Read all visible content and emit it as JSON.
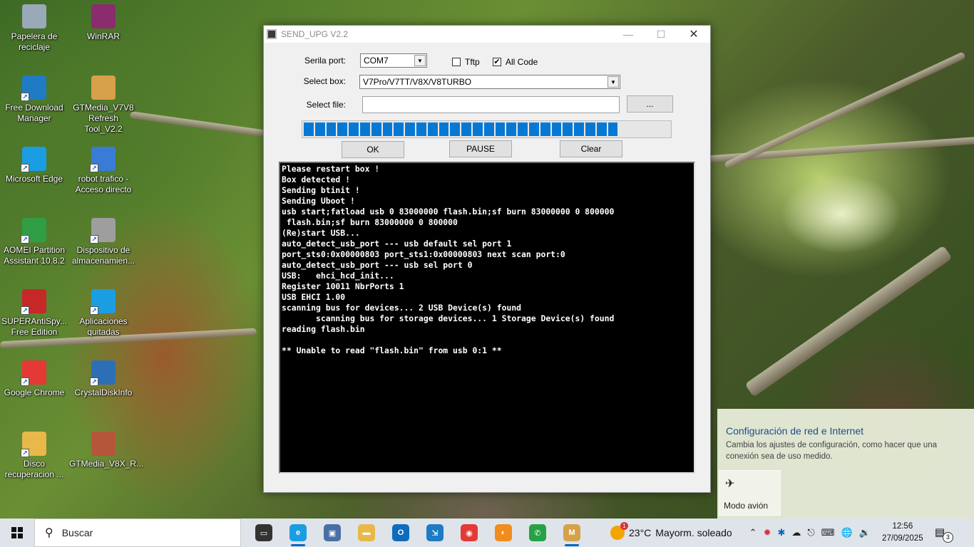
{
  "desktop": {
    "icons": [
      {
        "label": "Papelera de reciclaje",
        "icon": "recycle-bin-icon",
        "color": "#9aa9b8"
      },
      {
        "label": "WinRAR",
        "icon": "winrar-icon",
        "color": "#8b2c6e"
      },
      {
        "label": "Free Download Manager",
        "icon": "fdm-icon",
        "color": "#1f7bc4"
      },
      {
        "label": "GTMedia_V7V8 Refresh Tool_V2.2",
        "icon": "mfc-icon",
        "color": "#d6a14a"
      },
      {
        "label": "Microsoft Edge",
        "icon": "edge-icon",
        "color": "#1b9de2"
      },
      {
        "label": "robot trafico - Acceso directo",
        "icon": "shortcut-icon",
        "color": "#3a7bd5"
      },
      {
        "label": "AOMEI Partition Assistant 10.8.2",
        "icon": "aomei-icon",
        "color": "#2f9e44"
      },
      {
        "label": "Dispositivo de almacenamien...",
        "icon": "usb-drive-icon",
        "color": "#9e9e9e"
      },
      {
        "label": "SUPERAntiSpy... Free Edition",
        "icon": "superantispyware-icon",
        "color": "#c62828"
      },
      {
        "label": "Aplicaciones quitadas",
        "icon": "edge-icon",
        "color": "#1b9de2"
      },
      {
        "label": "Google Chrome",
        "icon": "chrome-icon",
        "color": "#e53935"
      },
      {
        "label": "CrystalDiskInfo",
        "icon": "crystaldiskinfo-icon",
        "color": "#2d6fb5"
      },
      {
        "label": "Disco recuperacion ...",
        "icon": "folder-icon",
        "color": "#e8b84a"
      },
      {
        "label": "GTMedia_V8X_R...",
        "icon": "winrar-archive-icon",
        "color": "#b5563a"
      }
    ]
  },
  "window": {
    "title": "SEND_UPG V2.2",
    "serial_port_label": "Serila port:",
    "serial_port_value": "COM7",
    "tftp_label": "Tftp",
    "tftp_checked": false,
    "allcode_label": "All Code",
    "allcode_checked": true,
    "checkmark": "✔",
    "select_box_label": "Select box:",
    "select_box_value": "V7Pro/V7TT/V8X/V8TURBO",
    "select_file_label": "Select file:",
    "select_file_value": "",
    "browse_label": "...",
    "progress_percent": 88,
    "ok_label": "OK",
    "pause_label": "PAUSE",
    "clear_label": "Clear",
    "console_text": "Please restart box !\nBox detected !\nSending btinit !\nSending Uboot !\nusb start;fatload usb 0 83000000 flash.bin;sf burn 83000000 0 800000\n flash.bin;sf burn 83000000 0 800000\n(Re)start USB...\nauto_detect_usb_port --- usb default sel port 1\nport_sts0:0x00000803 port_sts1:0x00000803 next scan port:0\nauto_detect_usb_port --- usb sel port 0\nUSB:   ehci_hcd_init...\nRegister 10011 NbrPorts 1\nUSB EHCI 1.00\nscanning bus for devices... 2 USB Device(s) found\n       scanning bus for storage devices... 1 Storage Device(s) found\nreading flash.bin\n\n** Unable to read \"flash.bin\" from usb 0:1 **"
  },
  "notification": {
    "title": "Configuración de red e Internet",
    "description": "Cambia los ajustes de configuración, como hacer que una conexión sea de uso medido.",
    "tile_label": "Modo avión"
  },
  "taskbar": {
    "search_placeholder": "Buscar",
    "apps": [
      {
        "name": "task-view-icon",
        "color": "#333333",
        "glyph": "▭"
      },
      {
        "name": "edge-icon",
        "color": "#1b9de2",
        "glyph": "e",
        "active": true
      },
      {
        "name": "photos-icon",
        "color": "#4a6fa5",
        "glyph": "▣"
      },
      {
        "name": "file-explorer-icon",
        "color": "#e8b84a",
        "glyph": "▬"
      },
      {
        "name": "outlook-icon",
        "color": "#0f6cbd",
        "glyph": "O"
      },
      {
        "name": "fdm-icon",
        "color": "#1f7bc4",
        "glyph": "⇲"
      },
      {
        "name": "chrome-icon",
        "color": "#e53935",
        "glyph": "◉"
      },
      {
        "name": "firefox-icon",
        "color": "#f28c1b",
        "glyph": "◐"
      },
      {
        "name": "whatsapp-icon",
        "color": "#25a244",
        "glyph": "✆"
      },
      {
        "name": "mfc-icon",
        "color": "#d6a14a",
        "glyph": "M",
        "active": true
      }
    ],
    "weather_temp": "23°C",
    "weather_desc": "Mayorm. soleado",
    "weather_badge": "1",
    "time": "12:56",
    "date": "27/09/2025",
    "notification_count": "3"
  }
}
